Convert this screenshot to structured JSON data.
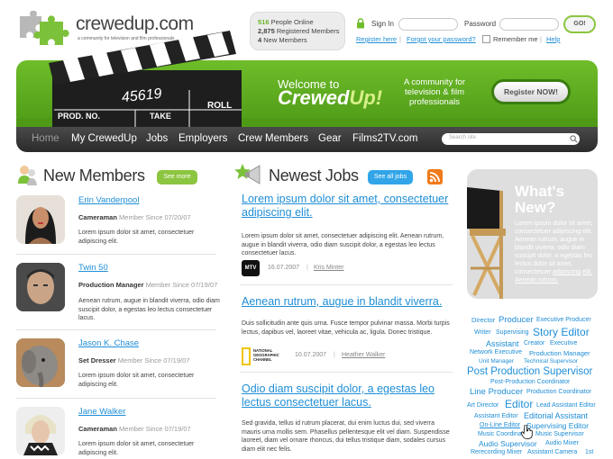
{
  "brand": {
    "name": "crewedup.com",
    "tagline": "a community for television and film professionals"
  },
  "stats": {
    "online_count": "516",
    "online_label": "People Online",
    "registered_count": "2,875",
    "registered_label": "Registered Members",
    "new_count": "4",
    "new_label": "New Members"
  },
  "login": {
    "signin_label": "Sign In",
    "password_label": "Password",
    "go_label": "GO!",
    "register_link": "Register here",
    "forgot_link": "Forgot your password?",
    "remember_label": "Remember me",
    "help_link": "Help"
  },
  "banner": {
    "clap_number": "45619",
    "clap_prod": "PROD. NO.",
    "clap_take": "TAKE",
    "clap_roll": "ROLL",
    "welcome_line1": "Welcome to",
    "welcome_line2a": "Crewed",
    "welcome_line2b": "Up!",
    "community": "A community for television & film professionals",
    "register_button": "Register NOW!"
  },
  "nav": {
    "items": [
      "Home",
      "My CrewedUp",
      "Jobs",
      "Employers",
      "Crew Members",
      "Gear",
      "Films2TV.com"
    ],
    "search_placeholder": "Search site"
  },
  "members": {
    "title": "New Members",
    "see_more": "See more",
    "list": [
      {
        "name": "Erin Vanderpool",
        "role": "Cameraman",
        "since": "Member Since 07/20/07",
        "text": "Lorem ipsum dolor sit amet, consectetuer adipiscing elit."
      },
      {
        "name": "Twin 50",
        "role": "Production Manager",
        "since": "Member Since 07/19/07",
        "text": "Aenean rutrum, augue in blandit viverra, odio diam suscipit dolor, a egestas leo lectus consectetuer lacus."
      },
      {
        "name": "Jason K. Chase",
        "role": "Set Dresser",
        "since": "Member Since 07/19/07",
        "text": "Lorem ipsum dolor sit amet, consectetuer adipiscing elit."
      },
      {
        "name": "Jane Walker",
        "role": "Cameraman",
        "since": "Member Since 07/19/07",
        "text": "Lorem ipsum dolor sit amet, consectetuer adipiscing elit."
      }
    ]
  },
  "jobs": {
    "title": "Newest Jobs",
    "see_all": "See all jobs",
    "list": [
      {
        "title": "Lorem ipsum dolor sit amet, consectetuer adipiscing elit.",
        "text": "Lorem ipsum dolor sit amet, consectetuer adipiscing elit. Aenean rutrum, augue in blandit viverra, odio diam suscipit dolor, a egestas leo lectus consectetuer lacus.",
        "date": "16.07.2007",
        "author": "Kris Minter",
        "logo": "MTV"
      },
      {
        "title": "Aenean rutrum, augue in blandit viverra.",
        "text": "Duis sollicitudin ante quis urna. Fusce tempor pulvinar massa. Morbi turpis lectus, dapibus vel, laoreet vitae, vehicula ac, ligula. Donec tristique.",
        "date": "10.07.2007",
        "author": "Heather Walker",
        "logo": "NATIONAL GEOGRAPHIC CHANNEL"
      },
      {
        "title": "Odio diam suscipit dolor, a egestas leo lectus consectetuer lacus.",
        "text": "Sed gravida, tellus id rutrum placerat, dui enim luctus dui, sed viverra mauris urna mollis sem. Phasellus pellentesque elit vel diam. Suspendisse laoreet, diam vel ornare rhoncus, dui tellus tristique diam, sodales cursus diam elit nec felis.",
        "date": "",
        "author": "",
        "logo": ""
      }
    ]
  },
  "whats_new": {
    "title1": "What's",
    "title2": "New?",
    "text": "Lorem ipsum dolor sit amet, consectetuer adipiscing elit. Aenean rutrum, augue in blandit viverra, odio diam suscipit dolor, a egestas leo lectus.dolor sit amet, consectetuer",
    "link1": "adipiscing",
    "link2": "elit. Aenean rutrum."
  },
  "tags": [
    "Director",
    "Producer",
    "Executive Producer",
    "Writer",
    "Supervising",
    "Story Editor",
    "Assistant",
    "Creator",
    "Executive",
    "Network Executive",
    "Production Manager",
    "Unit Manager",
    "Technical Supervisor",
    "Post Production Supervisor",
    "Post-Production Coordinator",
    "Line Producer",
    "Production Coordinator",
    "Art Director",
    "Editor",
    "Lead Assistant Editor",
    "Assistant Editor",
    "Editorial Assistant",
    "On-Line Editor",
    "Supervising Editor",
    "Music Coordinator",
    "Music Supervisor",
    "Audio Supervisor",
    "Audio Mixer",
    "Rerecording Mixer",
    "Assistant Camera",
    "1st"
  ],
  "colors": {
    "green": "#6fbd2a",
    "blue_link": "#1f8ed6",
    "nav_dark": "#2a2a2a"
  }
}
